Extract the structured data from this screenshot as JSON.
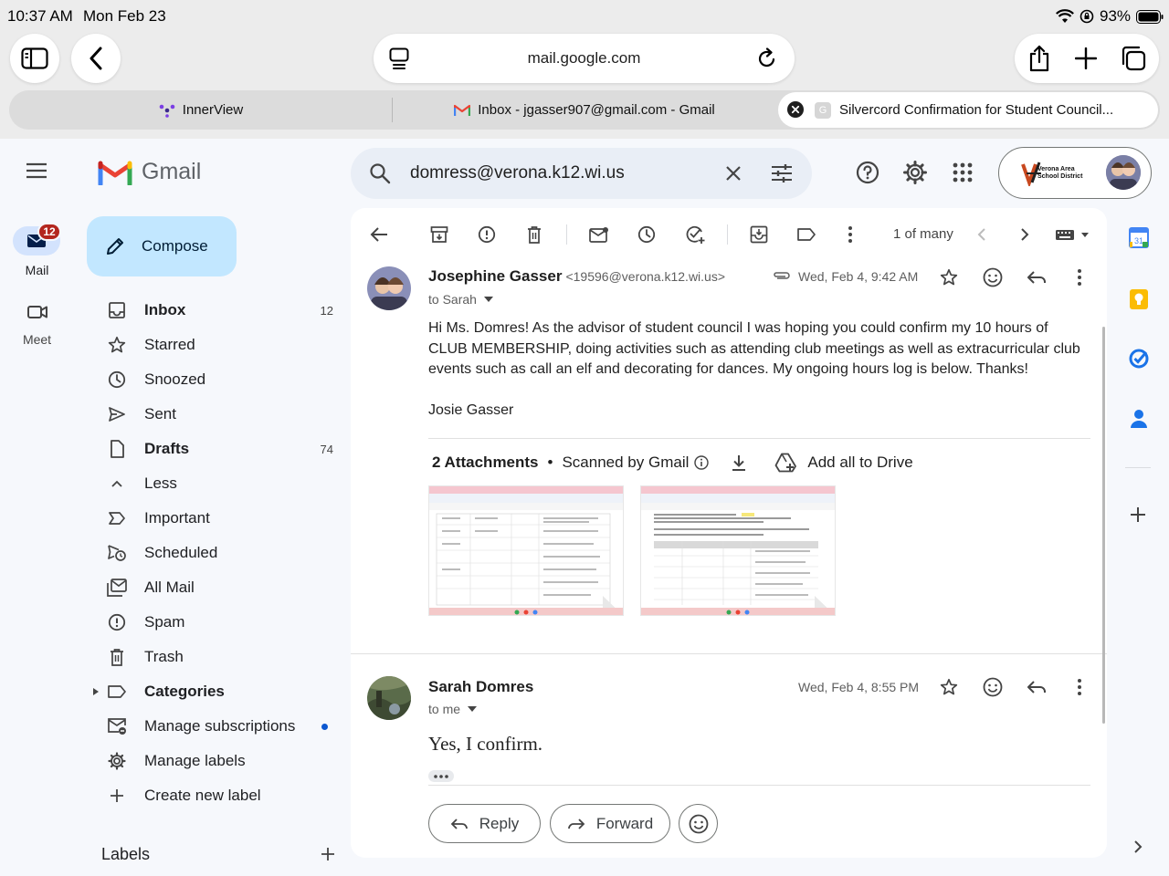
{
  "status": {
    "time": "10:37 AM",
    "date": "Mon Feb 23",
    "battery": "93%"
  },
  "safari": {
    "url": "mail.google.com",
    "tabs": [
      {
        "label": "InnerView"
      },
      {
        "label": "Inbox - jgasser907@gmail.com - Gmail"
      },
      {
        "label": "Silvercord Confirmation for Student Council..."
      }
    ]
  },
  "rail": {
    "mail_label": "Mail",
    "mail_badge": "12",
    "meet_label": "Meet"
  },
  "gmail": {
    "logo_text": "Gmail",
    "compose_label": "Compose",
    "search_value": "domress@verona.k12.wi.us",
    "org_logo_text_1": "Verona Area",
    "org_logo_text_2": "School District"
  },
  "nav": {
    "inbox": {
      "label": "Inbox",
      "count": "12"
    },
    "starred": {
      "label": "Starred"
    },
    "snoozed": {
      "label": "Snoozed"
    },
    "sent": {
      "label": "Sent"
    },
    "drafts": {
      "label": "Drafts",
      "count": "74"
    },
    "less": {
      "label": "Less"
    },
    "important": {
      "label": "Important"
    },
    "scheduled": {
      "label": "Scheduled"
    },
    "allmail": {
      "label": "All Mail"
    },
    "spam": {
      "label": "Spam"
    },
    "trash": {
      "label": "Trash"
    },
    "categories": {
      "label": "Categories"
    },
    "subscriptions": {
      "label": "Manage subscriptions"
    },
    "labels_manage": {
      "label": "Manage labels"
    },
    "new_label": {
      "label": "Create new label"
    },
    "labels_header": "Labels"
  },
  "toolbar": {
    "pager": "1 of many"
  },
  "message1": {
    "sender": "Josephine Gasser",
    "email": "<19596@verona.k12.wi.us>",
    "date": "Wed, Feb 4, 9:42 AM",
    "to": "to Sarah",
    "body": "Hi Ms. Domres! As the advisor of student council I was hoping you could confirm my 10 hours of CLUB MEMBERSHIP, doing activities such as attending club meetings as well as extracurricular club events such as call an elf and decorating for dances. My ongoing hours log is below. Thanks!",
    "signature": "Josie Gasser",
    "attachments_title": "2 Attachments",
    "scanned": "Scanned by Gmail",
    "add_drive": "Add all to Drive"
  },
  "message2": {
    "sender": "Sarah Domres",
    "date": "Wed, Feb 4, 8:55 PM",
    "to": "to me",
    "body": "Yes, I confirm."
  },
  "actions": {
    "reply": "Reply",
    "forward": "Forward"
  },
  "colors": {
    "compose_bg": "#c2e7ff",
    "badge": "#b3261e",
    "accent_blue": "#0b57d0"
  }
}
